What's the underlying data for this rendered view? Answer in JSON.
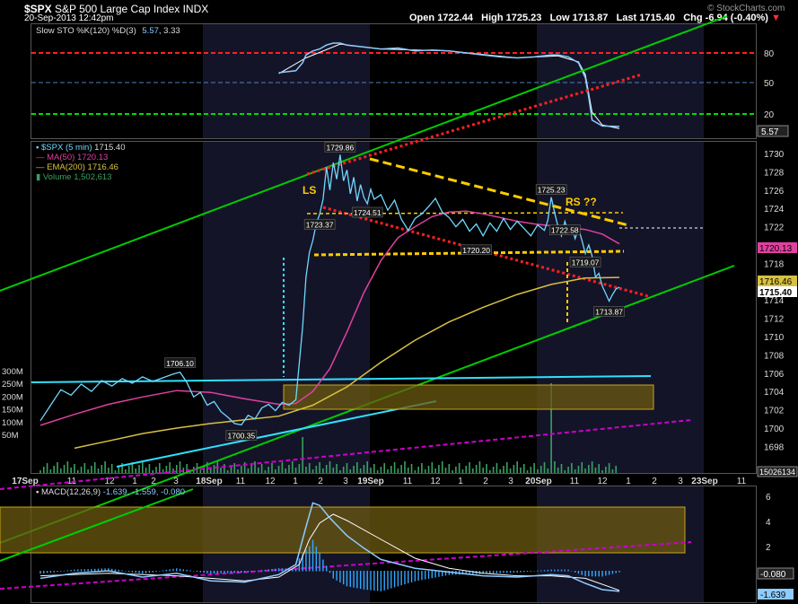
{
  "header": {
    "symbol": "$SPX",
    "name": "S&P 500 Large Cap Index",
    "exchange": "INDX",
    "datetime": "20-Sep-2013 12:42pm",
    "open_label": "Open",
    "open": "1722.44",
    "high_label": "High",
    "high": "1725.23",
    "low_label": "Low",
    "low": "1713.87",
    "last_label": "Last",
    "last": "1715.40",
    "chg_label": "Chg",
    "chg": "-6.94 (-0.40%)",
    "watermark": "© StockCharts.com"
  },
  "colors": {
    "price": "#6fd8ff",
    "ma50": "#e040a0",
    "ema200": "#d8c040",
    "volume": "#3aa060",
    "sto_k": "#8ecbff",
    "sto_d": "#ffffff",
    "trend_green": "#00cc00",
    "trend_red": "#ff2020",
    "trend_yellow": "#ffcc00",
    "trend_magenta": "#cc00cc",
    "trend_cyan": "#30e0ff",
    "box_fill": "#6b5a10",
    "session_shade": "#141428"
  },
  "sto_panel": {
    "legend": "Slow STO %K(120) %D(3)",
    "k": "5.57",
    "d": "3.33",
    "levels": [
      "80",
      "50",
      "20"
    ],
    "last_value": "5.57"
  },
  "price_panel": {
    "legend_symbol": "$SPX (5 min)",
    "legend_symbol_value": "1715.40",
    "legend_ma": "MA(50)",
    "legend_ma_value": "1720.13",
    "legend_ema": "EMA(200)",
    "legend_ema_value": "1716.46",
    "legend_volume": "Volume",
    "legend_volume_value": "1,502,613",
    "y_ticks": [
      "1730",
      "1728",
      "1726",
      "1724",
      "1722",
      "1720",
      "1718",
      "1716",
      "1714",
      "1712",
      "1710",
      "1708",
      "1706",
      "1704",
      "1702",
      "1700",
      "1698"
    ],
    "right_markers": [
      "1720.13",
      "1716.46",
      "1715.40"
    ],
    "volume_ticks": [
      "300M",
      "250M",
      "200M",
      "150M",
      "100M",
      "50M"
    ],
    "volume_last": "15026134",
    "annotations": {
      "ls": "LS",
      "rs": "RS ??",
      "p1729_86": "1729.86",
      "p1725_23": "1725.23",
      "p1724_51": "1724.51",
      "p1723_37": "1723.37",
      "p1722_58": "1722.58",
      "p1720_20": "1720.20",
      "p1719_07": "1719.07",
      "p1713_87": "1713.87",
      "p1706_10": "1706.10",
      "p1700_35": "1700.35"
    }
  },
  "x_axis": {
    "labels": [
      "17Sep",
      "11",
      "12",
      "1",
      "2",
      "3",
      "18Sep",
      "11",
      "12",
      "1",
      "2",
      "3",
      "19Sep",
      "11",
      "12",
      "1",
      "2",
      "3",
      "20Sep",
      "11",
      "12",
      "1",
      "2",
      "3",
      "23Sep",
      "11"
    ]
  },
  "macd_panel": {
    "legend": "MACD(12,26,9)",
    "values": "-1.639, -1.559, -0.080",
    "y_ticks": [
      "6",
      "4",
      "2"
    ],
    "right_markers": [
      "-0.080",
      "-1.639"
    ]
  },
  "chart_data": {
    "type": "line",
    "title": "$SPX S&P 500 Large Cap Index INDX",
    "x_sessions": [
      "17Sep",
      "18Sep",
      "19Sep",
      "20Sep"
    ],
    "price": {
      "name": "$SPX (5 min)",
      "points": [
        [
          0,
          1700.8
        ],
        [
          3,
          1702.5
        ],
        [
          6,
          1704.2
        ],
        [
          9,
          1703.6
        ],
        [
          12,
          1704.8
        ],
        [
          15,
          1704.0
        ],
        [
          18,
          1705.2
        ],
        [
          21,
          1704.6
        ],
        [
          24,
          1705.4
        ],
        [
          27,
          1704.9
        ],
        [
          30,
          1705.6
        ],
        [
          33,
          1705.1
        ],
        [
          36,
          1705.5
        ],
        [
          39,
          1705.9
        ],
        [
          41,
          1706.1
        ],
        [
          43,
          1705.0
        ],
        [
          45,
          1703.4
        ],
        [
          47,
          1703.9
        ],
        [
          49,
          1702.5
        ],
        [
          51,
          1702.9
        ],
        [
          53,
          1701.8
        ],
        [
          55,
          1701.2
        ],
        [
          57,
          1700.5
        ],
        [
          59,
          1700.35
        ],
        [
          61,
          1701.4
        ],
        [
          63,
          1701.0
        ],
        [
          65,
          1702.2
        ],
        [
          67,
          1702.6
        ],
        [
          69,
          1701.9
        ],
        [
          71,
          1702.8
        ],
        [
          73,
          1702.5
        ],
        [
          75,
          1703.1
        ],
        [
          77,
          1711.0
        ],
        [
          78,
          1716.5
        ],
        [
          79,
          1719.2
        ],
        [
          80,
          1720.5
        ],
        [
          81,
          1722.3
        ],
        [
          82,
          1723.37
        ],
        [
          83,
          1725.0
        ],
        [
          84,
          1728.5
        ],
        [
          85,
          1726.0
        ],
        [
          86,
          1729.0
        ],
        [
          87,
          1727.2
        ],
        [
          88,
          1729.86
        ],
        [
          89,
          1727.0
        ],
        [
          90,
          1728.2
        ],
        [
          91,
          1725.6
        ],
        [
          92,
          1727.4
        ],
        [
          93,
          1724.8
        ],
        [
          94,
          1726.6
        ],
        [
          95,
          1725.2
        ],
        [
          96,
          1724.51
        ],
        [
          97,
          1726.1
        ],
        [
          98,
          1725.0
        ],
        [
          100,
          1725.5
        ],
        [
          102,
          1723.8
        ],
        [
          104,
          1724.9
        ],
        [
          106,
          1722.8
        ],
        [
          108,
          1721.6
        ],
        [
          110,
          1722.9
        ],
        [
          112,
          1723.4
        ],
        [
          114,
          1724.2
        ],
        [
          116,
          1725.1
        ],
        [
          118,
          1723.6
        ],
        [
          120,
          1723.0
        ],
        [
          122,
          1722.0
        ],
        [
          124,
          1722.8
        ],
        [
          126,
          1721.5
        ],
        [
          128,
          1722.3
        ],
        [
          130,
          1721.0
        ],
        [
          132,
          1722.4
        ],
        [
          134,
          1721.5
        ],
        [
          136,
          1722.9
        ],
        [
          138,
          1721.7
        ],
        [
          140,
          1722.6
        ],
        [
          142,
          1721.8
        ],
        [
          144,
          1721.0
        ],
        [
          146,
          1722.2
        ],
        [
          148,
          1721.6
        ],
        [
          149,
          1722.7
        ],
        [
          150,
          1725.23
        ],
        [
          151,
          1723.5
        ],
        [
          152,
          1722.0
        ],
        [
          153,
          1721.0
        ],
        [
          154,
          1722.58
        ],
        [
          155,
          1721.3
        ],
        [
          156,
          1722.0
        ],
        [
          157,
          1720.7
        ],
        [
          158,
          1721.8
        ],
        [
          159,
          1720.5
        ],
        [
          160,
          1719.07
        ],
        [
          161,
          1720.0
        ],
        [
          162,
          1718.8
        ],
        [
          163,
          1716.5
        ],
        [
          164,
          1716.9
        ],
        [
          165,
          1715.5
        ],
        [
          166,
          1714.7
        ],
        [
          167,
          1713.87
        ],
        [
          168,
          1714.6
        ],
        [
          169,
          1715.2
        ],
        [
          170,
          1715.4
        ]
      ]
    },
    "ma50": {
      "name": "MA(50)",
      "points": [
        [
          0,
          1700.3
        ],
        [
          10,
          1701.5
        ],
        [
          20,
          1702.6
        ],
        [
          30,
          1703.4
        ],
        [
          40,
          1704.1
        ],
        [
          50,
          1703.9
        ],
        [
          60,
          1703.2
        ],
        [
          70,
          1702.6
        ],
        [
          75,
          1702.7
        ],
        [
          80,
          1704.0
        ],
        [
          85,
          1706.5
        ],
        [
          90,
          1710.5
        ],
        [
          95,
          1714.8
        ],
        [
          100,
          1718.3
        ],
        [
          105,
          1720.8
        ],
        [
          110,
          1722.0
        ],
        [
          115,
          1723.1
        ],
        [
          120,
          1723.6
        ],
        [
          125,
          1723.7
        ],
        [
          130,
          1723.4
        ],
        [
          135,
          1723.0
        ],
        [
          140,
          1722.6
        ],
        [
          145,
          1722.3
        ],
        [
          150,
          1722.1
        ],
        [
          155,
          1721.9
        ],
        [
          160,
          1721.7
        ],
        [
          165,
          1721.2
        ],
        [
          170,
          1720.13
        ]
      ]
    },
    "ema200": {
      "name": "EMA(200)",
      "points": [
        [
          10,
          1697.8
        ],
        [
          20,
          1698.6
        ],
        [
          30,
          1699.4
        ],
        [
          40,
          1700.0
        ],
        [
          50,
          1700.5
        ],
        [
          60,
          1700.9
        ],
        [
          70,
          1701.3
        ],
        [
          80,
          1702.5
        ],
        [
          90,
          1704.5
        ],
        [
          100,
          1707.2
        ],
        [
          110,
          1709.6
        ],
        [
          120,
          1711.6
        ],
        [
          130,
          1713.2
        ],
        [
          140,
          1714.6
        ],
        [
          150,
          1715.7
        ],
        [
          160,
          1716.4
        ],
        [
          170,
          1716.46
        ]
      ]
    },
    "sto_k": {
      "name": "%K(120)",
      "points": [
        [
          70,
          60
        ],
        [
          75,
          62
        ],
        [
          77,
          70
        ],
        [
          78,
          78
        ],
        [
          80,
          82
        ],
        [
          82,
          84
        ],
        [
          84,
          88
        ],
        [
          86,
          90
        ],
        [
          88,
          90
        ],
        [
          90,
          88
        ],
        [
          95,
          86
        ],
        [
          100,
          84
        ],
        [
          105,
          85
        ],
        [
          110,
          82
        ],
        [
          115,
          83
        ],
        [
          120,
          82
        ],
        [
          125,
          80
        ],
        [
          130,
          78
        ],
        [
          135,
          76
        ],
        [
          140,
          75
        ],
        [
          145,
          76
        ],
        [
          150,
          78
        ],
        [
          152,
          78
        ],
        [
          155,
          76
        ],
        [
          158,
          70
        ],
        [
          160,
          55
        ],
        [
          161,
          35
        ],
        [
          162,
          12
        ],
        [
          165,
          6
        ],
        [
          170,
          5.57
        ]
      ]
    },
    "sto_d": {
      "name": "%D(3)",
      "points": [
        [
          70,
          59
        ],
        [
          78,
          75
        ],
        [
          88,
          89
        ],
        [
          100,
          84
        ],
        [
          120,
          82
        ],
        [
          140,
          75
        ],
        [
          152,
          77
        ],
        [
          158,
          71
        ],
        [
          160,
          58
        ],
        [
          162,
          20
        ],
        [
          165,
          7
        ],
        [
          170,
          3.33
        ]
      ]
    },
    "macd": {
      "name": "MACD(12,26,9)",
      "values": [
        -1.639,
        -1.559,
        -0.08
      ],
      "line": [
        [
          0,
          -0.6
        ],
        [
          10,
          -0.2
        ],
        [
          20,
          0.0
        ],
        [
          30,
          -0.5
        ],
        [
          40,
          -0.2
        ],
        [
          50,
          -0.8
        ],
        [
          60,
          -0.9
        ],
        [
          70,
          -0.3
        ],
        [
          75,
          0.5
        ],
        [
          78,
          3.5
        ],
        [
          80,
          5.4
        ],
        [
          82,
          5.2
        ],
        [
          85,
          4.2
        ],
        [
          90,
          2.8
        ],
        [
          95,
          1.8
        ],
        [
          100,
          0.9
        ],
        [
          110,
          0.2
        ],
        [
          120,
          -0.1
        ],
        [
          130,
          -0.4
        ],
        [
          140,
          -0.5
        ],
        [
          150,
          -0.3
        ],
        [
          155,
          -0.4
        ],
        [
          160,
          -1.0
        ],
        [
          165,
          -1.5
        ],
        [
          170,
          -1.639
        ]
      ],
      "signal": [
        [
          0,
          -0.4
        ],
        [
          20,
          -0.2
        ],
        [
          40,
          -0.4
        ],
        [
          60,
          -0.8
        ],
        [
          70,
          -0.5
        ],
        [
          76,
          0.5
        ],
        [
          79,
          2.5
        ],
        [
          82,
          3.8
        ],
        [
          86,
          4.5
        ],
        [
          90,
          4.0
        ],
        [
          100,
          2.5
        ],
        [
          110,
          1.0
        ],
        [
          120,
          0.2
        ],
        [
          130,
          -0.2
        ],
        [
          140,
          -0.4
        ],
        [
          150,
          -0.4
        ],
        [
          160,
          -0.6
        ],
        [
          170,
          -1.559
        ]
      ]
    },
    "ylim_price": [
      1698,
      1731
    ],
    "ylim_sto": [
      0,
      100
    ],
    "ylim_macd": [
      -2,
      6.5
    ],
    "grid": false
  }
}
